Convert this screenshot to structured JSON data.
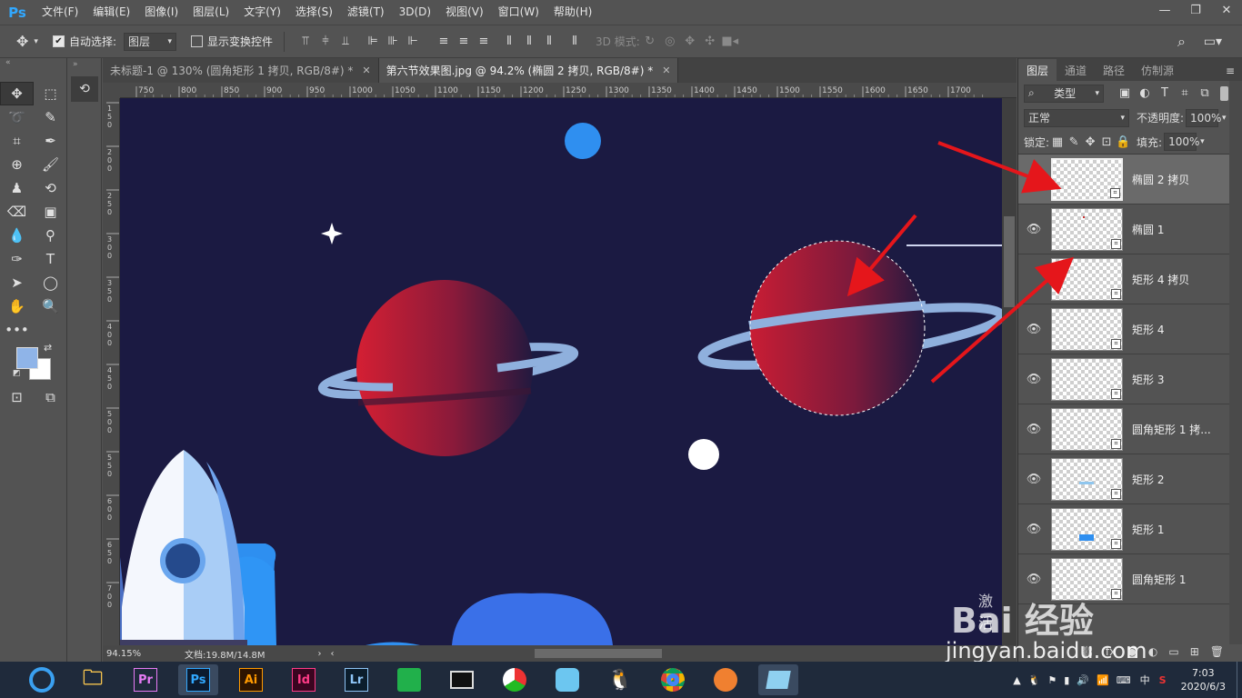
{
  "app": {
    "logo": "Ps",
    "menu": [
      "文件(F)",
      "编辑(E)",
      "图像(I)",
      "图层(L)",
      "文字(Y)",
      "选择(S)",
      "滤镜(T)",
      "3D(D)",
      "视图(V)",
      "窗口(W)",
      "帮助(H)"
    ],
    "window_controls": [
      "—",
      "❐",
      "✕"
    ]
  },
  "options": {
    "auto_select_label": "自动选择:",
    "auto_select_checked": true,
    "target_select": "图层",
    "transform_label": "显示变换控件",
    "transform_checked": false,
    "mode3d_label": "3D 模式:"
  },
  "tabs": [
    {
      "label": "未标题-1 @ 130% (圆角矩形 1 拷贝, RGB/8#) *",
      "active": false
    },
    {
      "label": "第六节效果图.jpg @ 94.2% (椭圆 2 拷贝, RGB/8#) *",
      "active": true
    }
  ],
  "ruler": {
    "top_ticks": [
      "750",
      "800",
      "850",
      "900",
      "950",
      "1000",
      "1050",
      "1100",
      "1150",
      "1200",
      "1250",
      "1300",
      "1350",
      "1400",
      "1450",
      "1500",
      "1550",
      "1600",
      "1650",
      "1700"
    ],
    "left_ticks": [
      "1\n5\n0",
      "2\n0\n0",
      "2\n5\n0",
      "3\n0\n0",
      "3\n5\n0",
      "4\n0\n0",
      "4\n5\n0",
      "5\n0\n0",
      "5\n5\n0",
      "6\n0\n0",
      "6\n5\n0",
      "7\n0\n0"
    ]
  },
  "status": {
    "zoom": "94.15%",
    "doc": "文档:19.8M/14.8M"
  },
  "panel": {
    "tabs": [
      "图层",
      "通道",
      "路径",
      "仿制源"
    ],
    "kind_label": "类型",
    "blend_mode": "正常",
    "opacity_label": "不透明度:",
    "opacity_value": "100%",
    "lock_label": "锁定:",
    "fill_label": "填充:",
    "fill_value": "100%",
    "layers": [
      {
        "name": "椭圆 2 拷贝",
        "selected": true
      },
      {
        "name": "椭圆 1",
        "selected": false
      },
      {
        "name": "矩形 4 拷贝",
        "selected": false
      },
      {
        "name": "矩形 4",
        "selected": false
      },
      {
        "name": "矩形 3",
        "selected": false
      },
      {
        "name": "圆角矩形 1 拷...",
        "selected": false
      },
      {
        "name": "矩形 2",
        "selected": false
      },
      {
        "name": "矩形 1",
        "selected": false
      },
      {
        "name": "圆角矩形 1",
        "selected": false
      }
    ]
  },
  "taskbar": {
    "apps": [
      {
        "label": "Pr",
        "color": "#2b0f3c",
        "text_color": "#e77bf5"
      },
      {
        "label": "Ps",
        "color": "#0c1a2e",
        "text_color": "#31a8ff"
      },
      {
        "label": "Ai",
        "color": "#2e1400",
        "text_color": "#ff9a00"
      },
      {
        "label": "Id",
        "color": "#3a0520",
        "text_color": "#ff3b87"
      },
      {
        "label": "Lr",
        "color": "#0b1d2c",
        "text_color": "#8dc4f5"
      }
    ],
    "time": "7:03",
    "date": "2020/6/3",
    "ime": "中"
  },
  "watermark": {
    "text": "Bai 经验",
    "url": "jingyan.baidu.com",
    "activate": "激活"
  },
  "colors": {
    "canvas_bg": "#1b1a42",
    "planet_red": "#d01e32",
    "ring_blue": "#8fb0dd",
    "arrow_red": "#e5161b",
    "foreground_swatch": "#8fb4e8",
    "background_swatch": "#ffffff"
  }
}
